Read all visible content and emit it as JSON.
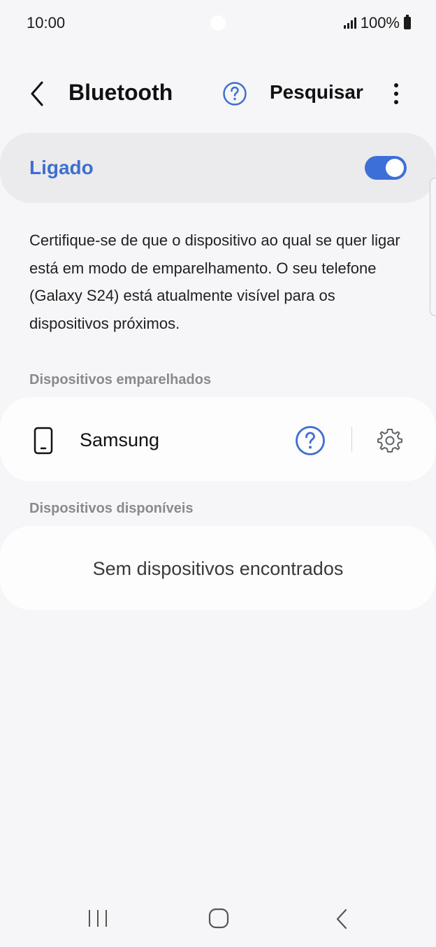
{
  "status_bar": {
    "time": "10:00",
    "battery": "100%"
  },
  "header": {
    "title": "Bluetooth",
    "back_icon": "chevron-left-icon",
    "help_icon": "help-circle-icon",
    "search_label": "Pesquisar",
    "more_icon": "more-vertical-icon"
  },
  "toggle": {
    "label": "Ligado",
    "state": "on",
    "accent_color": "#3d6fd8"
  },
  "description": "Certifique-se de que o dispositivo ao qual se quer ligar está em modo de emparelhamento. O seu telefone (Galaxy S24) está atualmente visível para os dispositivos próximos.",
  "paired": {
    "header": "Dispositivos emparelhados",
    "devices": [
      {
        "name": "Samsung",
        "icon": "phone-icon"
      }
    ]
  },
  "available": {
    "header": "Dispositivos disponíveis",
    "empty_text": "Sem dispositivos encontrados"
  },
  "nav_bar": {
    "recent_icon": "recent-apps-icon",
    "home_icon": "home-icon",
    "back_icon": "back-icon"
  }
}
